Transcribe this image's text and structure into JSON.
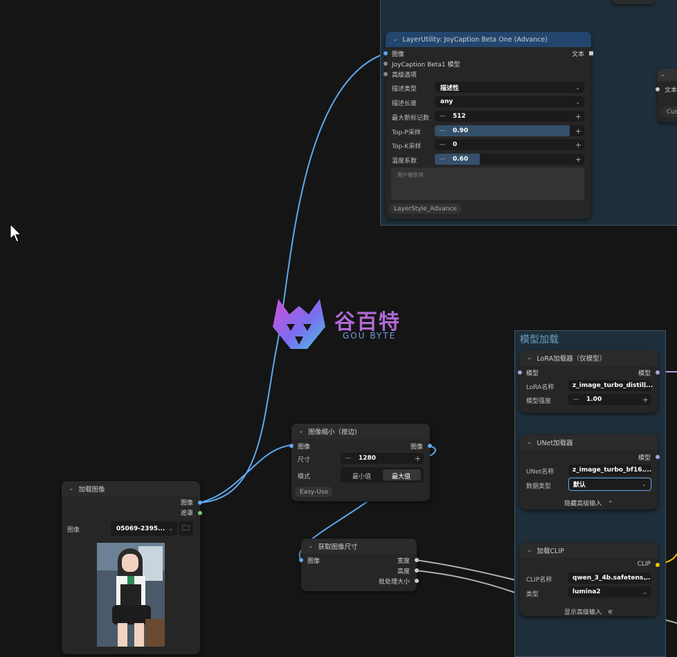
{
  "joy": {
    "title": "LayerUtility: JoyCaption Beta One (Advance)",
    "in_image": "图像",
    "in_model": "JoyCaption Beta1 模型",
    "in_adv": "高级选项",
    "out_text": "文本",
    "desc_type_label": "描述类型",
    "desc_type_value": "描述性",
    "desc_len_label": "描述长度",
    "desc_len_value": "any",
    "max_tokens_label": "最大新标记数",
    "max_tokens_value": "512",
    "top_p_label": "Top-P采样",
    "top_p_value": "0.90",
    "top_k_label": "Top-K采样",
    "top_k_value": "0",
    "temp_label": "温度系数",
    "temp_value": "0.60",
    "prompt_placeholder": "用户提示词",
    "badge": "LayerStyle_Advance"
  },
  "right_partial": {
    "in_text": "文本",
    "cus": "Cus"
  },
  "watermark": {
    "cn": "谷百特",
    "en": "GOU BYTE"
  },
  "model_group": {
    "title": "模型加载",
    "lora": {
      "title": "LoRA加载器（仅模型）",
      "in_model": "模型",
      "out_model": "模型",
      "name_label": "LoRA名称",
      "name_value": "z_image_turbo_distill...",
      "strength_label": "模型强度",
      "strength_value": "1.00"
    },
    "unet": {
      "title": "UNet加载器",
      "out_model": "模型",
      "name_label": "UNet名称",
      "name_value": "z_image_turbo_bf16....",
      "dtype_label": "数据类型",
      "dtype_value": "默认",
      "hide_adv": "隐藏高级输入"
    },
    "clip": {
      "title": "加载CLIP",
      "out_clip": "CLIP",
      "name_label": "CLIP名称",
      "name_value": "qwen_3_4b.safetens...",
      "type_label": "类型",
      "type_value": "lumina2",
      "show_adv": "显示高级输入"
    }
  },
  "scale": {
    "title": "图像缩小（按边)",
    "in_image": "图像",
    "out_image": "图像",
    "size_label": "尺寸",
    "size_value": "1280",
    "mode_label": "模式",
    "mode_min": "最小值",
    "mode_max": "最大值",
    "badge": "Easy-Use"
  },
  "load": {
    "title": "加载图像",
    "out_image": "图像",
    "out_mask": "遮罩",
    "image_label": "图像",
    "image_value": "05069-2395..."
  },
  "size": {
    "title": "获取图像尺寸",
    "in_image": "图像",
    "out_w": "宽度",
    "out_h": "高度",
    "out_batch": "批处理大小"
  },
  "colors": {
    "image_link": "#5ea9f0",
    "model_link": "#b39ddb",
    "clip_link": "#f5c400",
    "gray_link": "#aab4a8"
  }
}
